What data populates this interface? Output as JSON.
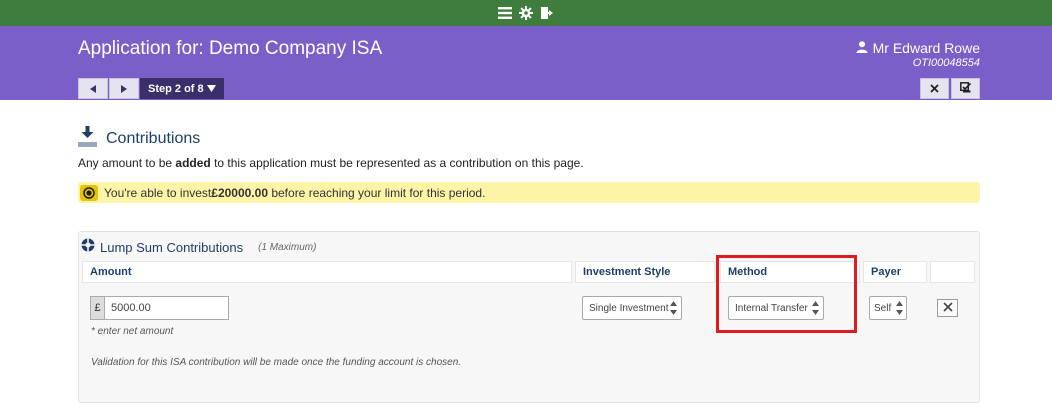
{
  "header": {
    "title": "Application for: Demo Company ISA",
    "user_name": "Mr Edward Rowe",
    "user_id": "OTI00048554",
    "step_label": "Step 2 of 8"
  },
  "section": {
    "title": "Contributions",
    "intro_before": "Any amount to be ",
    "intro_bold": "added",
    "intro_after": " to this application must be represented as a contribution on this page."
  },
  "alert": {
    "before": "You're able to invest ",
    "amount": "£20000.00",
    "after": " before reaching your limit for this period."
  },
  "lump_sum": {
    "title": "Lump Sum Contributions",
    "max_note": "(1 Maximum)",
    "columns": {
      "amount": "Amount",
      "investment_style": "Investment Style",
      "method": "Method",
      "payer": "Payer"
    },
    "row": {
      "currency": "£",
      "amount_value": "5000.00",
      "investment_style": "Single Investment",
      "method": "Internal Transfer",
      "payer": "Self"
    },
    "hint": "* enter net amount",
    "validation_note": "Validation for this ISA contribution will be made once the funding account is chosen."
  },
  "colors": {
    "top_bar": "#3f7d3e",
    "header": "#7b5fc8",
    "step_bg": "#3c2d6b",
    "heading_text": "#1e3f66",
    "alert_bg": "#fdf4a8",
    "highlight": "#e0191e"
  },
  "icons": {
    "top_bar": [
      "menu-icon",
      "gear-icon",
      "logout-icon"
    ],
    "user": "user-icon",
    "prev": "triangle-left-icon",
    "next": "triangle-right-icon",
    "close": "close-icon",
    "save": "save-check-icon",
    "section": "download-icon",
    "alert": "circle-dot-icon",
    "panel": "life-ring-icon",
    "remove": "remove-x-icon"
  }
}
